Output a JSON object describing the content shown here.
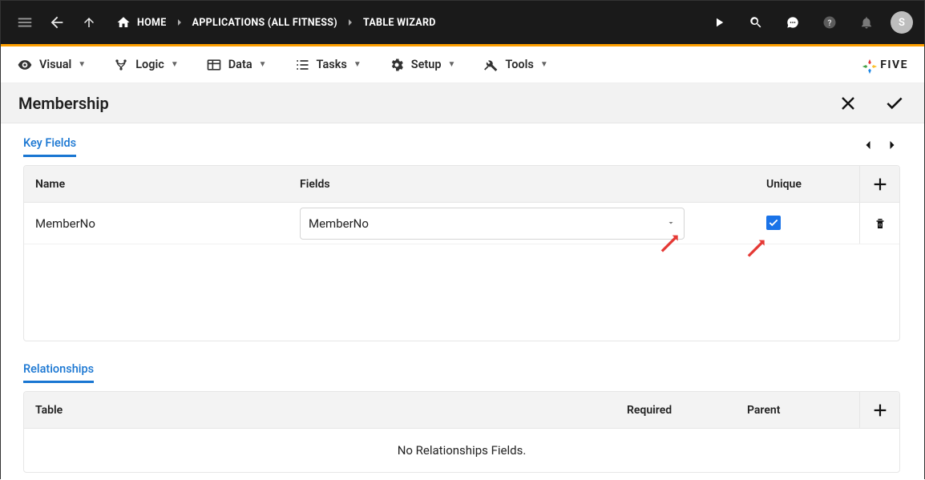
{
  "topbar": {
    "breadcrumb": [
      "HOME",
      "APPLICATIONS (ALL FITNESS)",
      "TABLE WIZARD"
    ],
    "avatar_initial": "S"
  },
  "secnav": {
    "items": [
      {
        "label": "Visual",
        "icon": "eye"
      },
      {
        "label": "Logic",
        "icon": "logic"
      },
      {
        "label": "Data",
        "icon": "table"
      },
      {
        "label": "Tasks",
        "icon": "list"
      },
      {
        "label": "Setup",
        "icon": "gear"
      },
      {
        "label": "Tools",
        "icon": "wrench"
      }
    ],
    "brand": "FIVE"
  },
  "titlebar": {
    "title": "Membership"
  },
  "key_fields": {
    "section_label": "Key Fields",
    "headers": {
      "name": "Name",
      "fields": "Fields",
      "unique": "Unique"
    },
    "rows": [
      {
        "name": "MemberNo",
        "field_selected": "MemberNo",
        "unique": true
      }
    ]
  },
  "relationships": {
    "section_label": "Relationships",
    "headers": {
      "table": "Table",
      "required": "Required",
      "parent": "Parent"
    },
    "empty_message": "No Relationships Fields."
  }
}
